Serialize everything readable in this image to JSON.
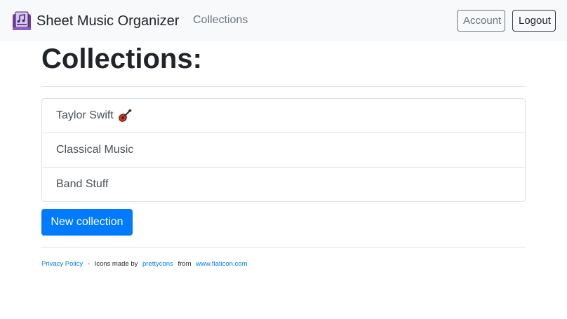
{
  "navbar": {
    "brand_title": "Sheet Music Organizer",
    "brand_icon": "sheet-music-icon",
    "nav_link": "Collections",
    "account_label": "Account",
    "logout_label": "Logout"
  },
  "main": {
    "title": "Collections:",
    "collections": [
      {
        "label": "Taylor Swift",
        "icon": "guitar-icon"
      },
      {
        "label": "Classical Music"
      },
      {
        "label": "Band Stuff"
      }
    ],
    "new_collection_label": "New collection"
  },
  "footer": {
    "privacy_label": "Privacy Policy",
    "separator": "-",
    "icons_prefix": "Icons made by",
    "author_label": "prettycons",
    "from_label": "from",
    "site_label": "www.flaticon.com"
  },
  "colors": {
    "primary": "#007bff",
    "navbar_bg": "#f8f9fa",
    "muted_text": "#6c757d",
    "logo_purple": "#7b4397"
  }
}
